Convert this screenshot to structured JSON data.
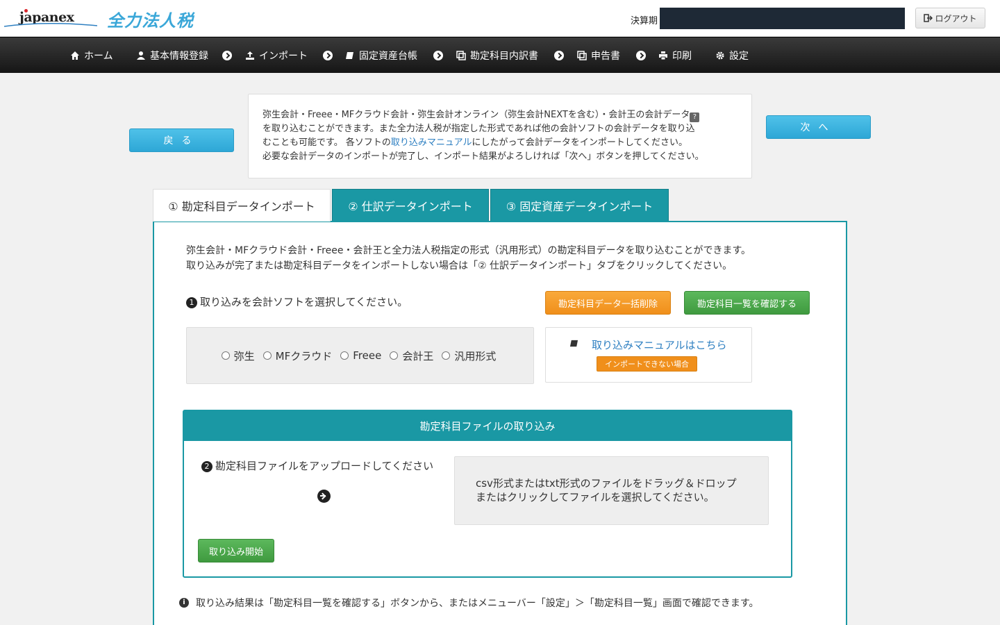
{
  "header": {
    "logo_text": "japanex",
    "product_name": "全力法人税",
    "fiscal_label": "決算期",
    "logout_label": "ログアウト"
  },
  "nav": {
    "items": [
      {
        "label": "ホーム",
        "icon": "home-icon"
      },
      {
        "label": "基本情報登録",
        "icon": "user-icon"
      },
      {
        "label": "インポート",
        "icon": "upload-icon"
      },
      {
        "label": "固定資産台帳",
        "icon": "book-icon"
      },
      {
        "label": "勘定科目内訳書",
        "icon": "copy-icon"
      },
      {
        "label": "申告書",
        "icon": "copy-icon"
      },
      {
        "label": "印刷",
        "icon": "print-icon"
      },
      {
        "label": "設定",
        "icon": "gear-icon"
      }
    ]
  },
  "actions": {
    "back_label": "戻る",
    "next_label": "次へ"
  },
  "info": {
    "line1": "弥生会計・Freee・MFクラウド会計・弥生会計オンライン（弥生会計NEXTを含む）・会計王の会計データ",
    "help_mark": "?",
    "line2": "を取り込むことができます。また全力法人税が指定した形式であれば他の会計ソフトの会計データを取り込",
    "line3_pre": "むことも可能です。 各ソフトの",
    "line3_link": "取り込みマニュアル",
    "line3_post": "にしたがって会計データをインポートしてください。",
    "line4": "必要な会計データのインポートが完了し、インポート結果がよろしければ「次へ」ボタンを押してください。"
  },
  "tabs": [
    {
      "label": "① 勘定科目データインポート",
      "active": true
    },
    {
      "label": "② 仕訳データインポート",
      "active": false
    },
    {
      "label": "③ 固定資産データインポート",
      "active": false
    }
  ],
  "panel": {
    "desc1": "弥生会計・MFクラウド会計・Freee・会計王と全力法人税指定の形式（汎用形式）の勘定科目データを取り込むことができます。",
    "desc2": "取り込みが完了または勘定科目データをインポートしない場合は「② 仕訳データインポート」タブをクリックしてください。",
    "step1_num": "1",
    "step1_text": "取り込みを会計ソフトを選択してください。",
    "bulk_delete_label": "勘定科目データ一括削除",
    "view_list_label": "勘定科目一覧を確認する",
    "software_options": [
      "弥生",
      "MFクラウド",
      "Freee",
      "会計王",
      "汎用形式"
    ],
    "manual_link": "取り込みマニュアルはこちら",
    "cannot_import_label": "インポートできない場合",
    "upload": {
      "title": "勘定科目ファイルの取り込み",
      "step2_num": "2",
      "step2_text": "勘定科目ファイルをアップロードしてください",
      "dropzone_line1": "csv形式またはtxt形式のファイルをドラッグ＆ドロップ",
      "dropzone_line2": "またはクリックしてファイルを選択してください。",
      "start_label": "取り込み開始"
    },
    "footnote_icon": "i",
    "footnote": "取り込み結果は「勘定科目一覧を確認する」ボタンから、またはメニューバー「設定」＞「勘定科目一覧」画面で確認できます。"
  },
  "colors": {
    "teal": "#1a98a4",
    "blue": "#2da7d6",
    "orange": "#f08f1b",
    "green": "#449d44",
    "nav_dark": "#222222"
  }
}
